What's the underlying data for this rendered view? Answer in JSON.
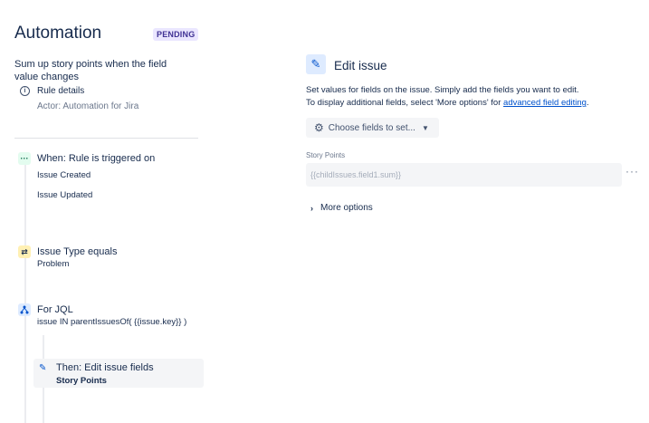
{
  "header": {
    "title": "Automation",
    "status_badge": "PENDING"
  },
  "rule": {
    "name": "Sum up story points when the field value changes",
    "details_label": "Rule details",
    "actor": "Actor: Automation for Jira"
  },
  "steps": {
    "trigger": {
      "title": "When: Rule is triggered on",
      "events": [
        "Issue Created",
        "Issue Updated"
      ]
    },
    "condition": {
      "title": "Issue Type equals",
      "value": "Problem"
    },
    "branch": {
      "title": "For JQL",
      "query": "issue IN parentIssuesOf( {{issue.key}} )"
    },
    "action": {
      "title": "Then: Edit issue fields",
      "field": "Story Points"
    }
  },
  "editor": {
    "title": "Edit issue",
    "description_line1": "Set values for fields on the issue. Simply add the fields you want to edit.",
    "description_line2_prefix": "To display additional fields, select 'More options' for ",
    "description_link": "advanced field editing",
    "description_line2_suffix": ".",
    "choose_fields_label": "Choose fields to set...",
    "field_label": "Story Points",
    "field_value": "{{childIssues.field1.sum}}",
    "more_options_label": "More options"
  },
  "icons": {
    "info": "info-icon",
    "trigger": "ellipsis-icon",
    "condition": "shuffle-icon",
    "branch": "branch-icon",
    "edit": "pencil-icon",
    "gear": "gear-icon",
    "chevron_down": "chevron-down-icon",
    "chevron_right": "chevron-right-icon",
    "more": "more-icon"
  }
}
